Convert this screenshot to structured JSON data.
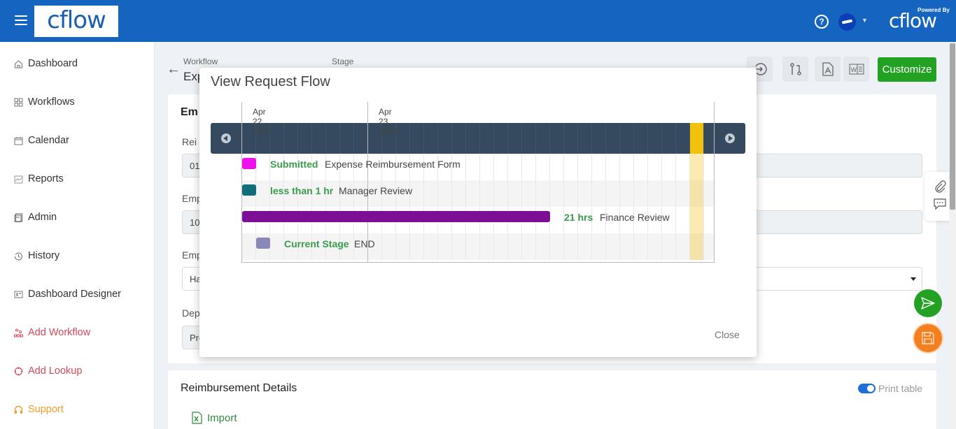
{
  "topbar": {
    "logo_text": "cflow",
    "powered_by": "Powered By",
    "powered_logo": "cflow",
    "help_glyph": "?",
    "caret_glyph": "⌄"
  },
  "sidebar": {
    "items": [
      {
        "label": "Dashboard",
        "icon": "home-icon",
        "color": "#333333"
      },
      {
        "label": "Workflows",
        "icon": "grid-icon",
        "color": "#333333"
      },
      {
        "label": "Calendar",
        "icon": "calendar-icon",
        "color": "#333333"
      },
      {
        "label": "Reports",
        "icon": "reports-icon",
        "color": "#333333"
      },
      {
        "label": "Admin",
        "icon": "admin-icon",
        "color": "#333333"
      },
      {
        "label": "History",
        "icon": "history-icon",
        "color": "#333333"
      },
      {
        "label": "Dashboard Designer",
        "icon": "dashboard-designer-icon",
        "color": "#333333"
      },
      {
        "label": "Add Workflow",
        "icon": "add-workflow-icon",
        "color": "#d2475a"
      },
      {
        "label": "Add Lookup",
        "icon": "add-lookup-icon",
        "color": "#d2475a"
      },
      {
        "label": "Support",
        "icon": "headset-icon",
        "color": "#f09a2c"
      }
    ]
  },
  "header": {
    "workflow_label": "Workflow",
    "stage_label": "Stage",
    "title_partial": "Exp",
    "customize_label": "Customize",
    "toolbar_icons": [
      "submit-arrow-icon",
      "flow-icon",
      "pdf-icon",
      "word-icon"
    ]
  },
  "form": {
    "section_title_partial": "Em",
    "fields": [
      {
        "label_partial": "Rei",
        "value_partial": "01"
      },
      {
        "label_partial": "Emp",
        "value_partial": "10"
      },
      {
        "label_partial": "Emp",
        "value_partial": "Ha"
      },
      {
        "label_partial": "Dep",
        "value_partial": "Pro"
      }
    ]
  },
  "details": {
    "title": "Reimbursement Details",
    "import_label": "Import",
    "print_table_label": "Print table",
    "print_table_on": true
  },
  "modal": {
    "title": "View Request Flow",
    "close_label": "Close",
    "gantt": {
      "scale_labels": [
        "Apr 22 2020",
        "Apr 23 2020"
      ],
      "tasks": [
        {
          "duration": "Submitted",
          "name": "Expense Reimbursement Form",
          "color": "#ee11ee",
          "kind": "milestone"
        },
        {
          "duration": "less than 1 hr",
          "name": "Manager Review",
          "color": "#106e7a",
          "kind": "milestone"
        },
        {
          "duration": "21 hrs",
          "name": "Finance Review",
          "color": "#7b0f96",
          "kind": "bar"
        },
        {
          "duration": "Current Stage",
          "name": "END",
          "color": "#8a88b8",
          "kind": "milestone"
        }
      ],
      "today_color": "#f2c10e"
    }
  }
}
